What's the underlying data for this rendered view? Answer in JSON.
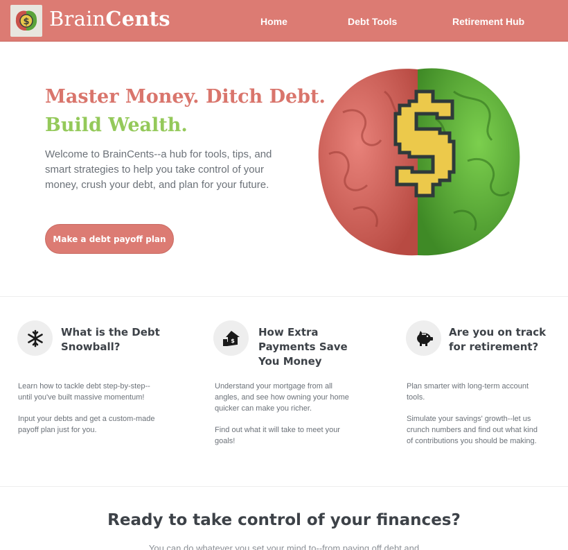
{
  "header": {
    "brand_part1": "Brain",
    "brand_part2": "Cents",
    "nav": [
      "Home",
      "Debt Tools",
      "Retirement Hub"
    ]
  },
  "hero": {
    "title_line1": "Master Money. Ditch Debt.",
    "title_line2": "Build Wealth.",
    "text": "Welcome to BrainCents--a hub for tools, tips, and smart strategies to help you take control of your money, crush your debt, and plan for your future.",
    "cta_label": "Make a debt payoff plan"
  },
  "features": [
    {
      "icon": "snowflake-icon",
      "title": "What is the Debt Snowball?",
      "p1": "Learn how to tackle debt step-by-step--until you've built massive momentum!",
      "p2": "Input your debts and get a custom-made payoff plan just for you."
    },
    {
      "icon": "home-money-icon",
      "title": "How Extra Payments Save You Money",
      "p1": "Understand your mortgage from all angles, and see how owning your home quicker can make you richer.",
      "p2": "Find out what it will take to meet your goals!"
    },
    {
      "icon": "piggy-bank-icon",
      "title": "Are you on track for retirement?",
      "p1": "Plan smarter with long-term account tools.",
      "p2": "Simulate your savings' growth--let us crunch numbers and find out what kind of contributions you should be making."
    }
  ],
  "cta_section": {
    "title": "Ready to take control of your finances?",
    "text": "You can do whatever you set your mind to--from paying off debt and"
  },
  "colors": {
    "brand": "#dc7b73",
    "accent_green": "#94c95a"
  }
}
